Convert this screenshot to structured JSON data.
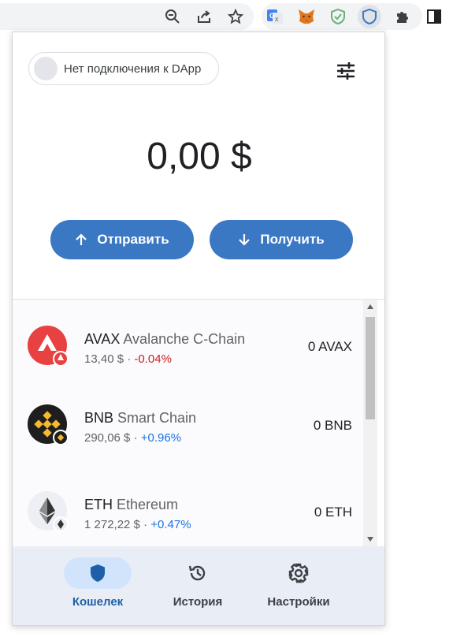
{
  "toolbar": {
    "icons": [
      "zoom-out-icon",
      "share-icon",
      "star-icon",
      "google-translate-icon",
      "metamask-icon",
      "adguard-icon",
      "trust-wallet-icon",
      "extensions-puzzle-icon",
      "side-panel-icon"
    ]
  },
  "header": {
    "dapp_status": "Нет подключения к DApp",
    "filter_icon": "sliders-icon"
  },
  "balance": {
    "total": "0,00 $"
  },
  "actions": {
    "send_label": "Отправить",
    "receive_label": "Получить"
  },
  "assets": [
    {
      "symbol": "AVAX",
      "name": "Avalanche C-Chain",
      "price": "13,40 $",
      "sep": "·",
      "change": "-0.04%",
      "change_dir": "neg",
      "balance": "0 AVAX",
      "icon": "avax-icon"
    },
    {
      "symbol": "BNB",
      "name": "Smart Chain",
      "price": "290,06 $",
      "sep": "·",
      "change": "+0.96%",
      "change_dir": "pos",
      "balance": "0 BNB",
      "icon": "bnb-icon"
    },
    {
      "symbol": "ETH",
      "name": "Ethereum",
      "price": "1 272,22 $",
      "sep": "·",
      "change": "+0.47%",
      "change_dir": "pos",
      "balance": "0 ETH",
      "icon": "eth-icon"
    }
  ],
  "nav": {
    "wallet_label": "Кошелек",
    "history_label": "История",
    "settings_label": "Настройки",
    "active": "wallet"
  },
  "colors": {
    "accent": "#3a78c4",
    "negative": "#c5221f",
    "positive": "#1a73e8",
    "nav_bg": "#e9eef6"
  }
}
